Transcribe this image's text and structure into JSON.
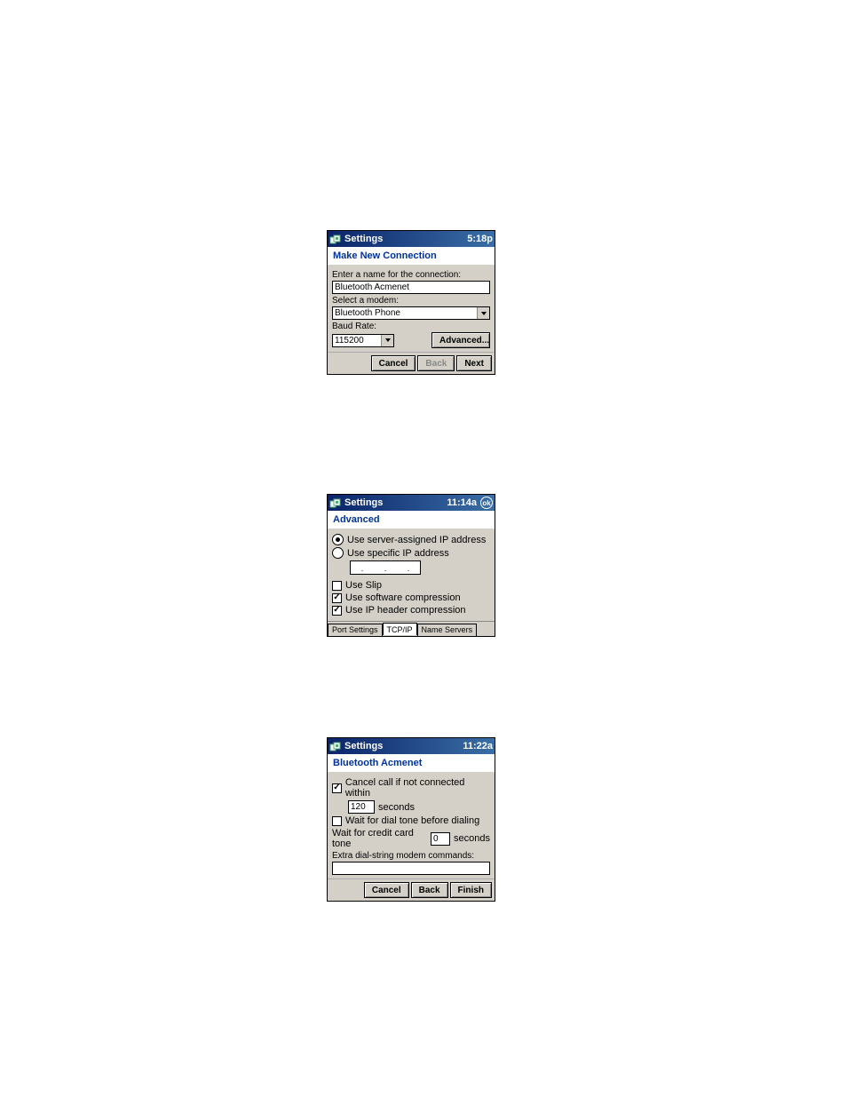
{
  "dialog1": {
    "title": "Settings",
    "time": "5:18p",
    "heading": "Make New Connection",
    "label_name": "Enter a name for the connection:",
    "name_value": "Bluetooth Acmenet",
    "label_modem": "Select a modem:",
    "modem_value": "Bluetooth Phone",
    "label_baud": "Baud Rate:",
    "baud_value": "115200",
    "advanced_btn": "Advanced...",
    "cancel": "Cancel",
    "back": "Back",
    "next": "Next"
  },
  "dialog2": {
    "title": "Settings",
    "time": "11:14a",
    "ok": "ok",
    "heading": "Advanced",
    "radio1": "Use server-assigned IP address",
    "radio2": "Use specific IP address",
    "ip_dots": ". . .",
    "check_slip": "Use Slip",
    "check_sw": "Use software compression",
    "check_ip": "Use IP header compression",
    "tab1": "Port Settings",
    "tab2": "TCP/IP",
    "tab3": "Name Servers"
  },
  "dialog3": {
    "title": "Settings",
    "time": "11:22a",
    "heading": "Bluetooth Acmenet",
    "check_cancel": "Cancel call if not connected within",
    "timeout_value": "120",
    "timeout_unit": "seconds",
    "check_wait": "Wait for dial tone before dialing",
    "credit_label1": "Wait for credit card tone",
    "credit_value": "0",
    "credit_label2": "seconds",
    "extra_label": "Extra dial-string modem commands:",
    "extra_value": "",
    "cancel": "Cancel",
    "back": "Back",
    "finish": "Finish"
  }
}
